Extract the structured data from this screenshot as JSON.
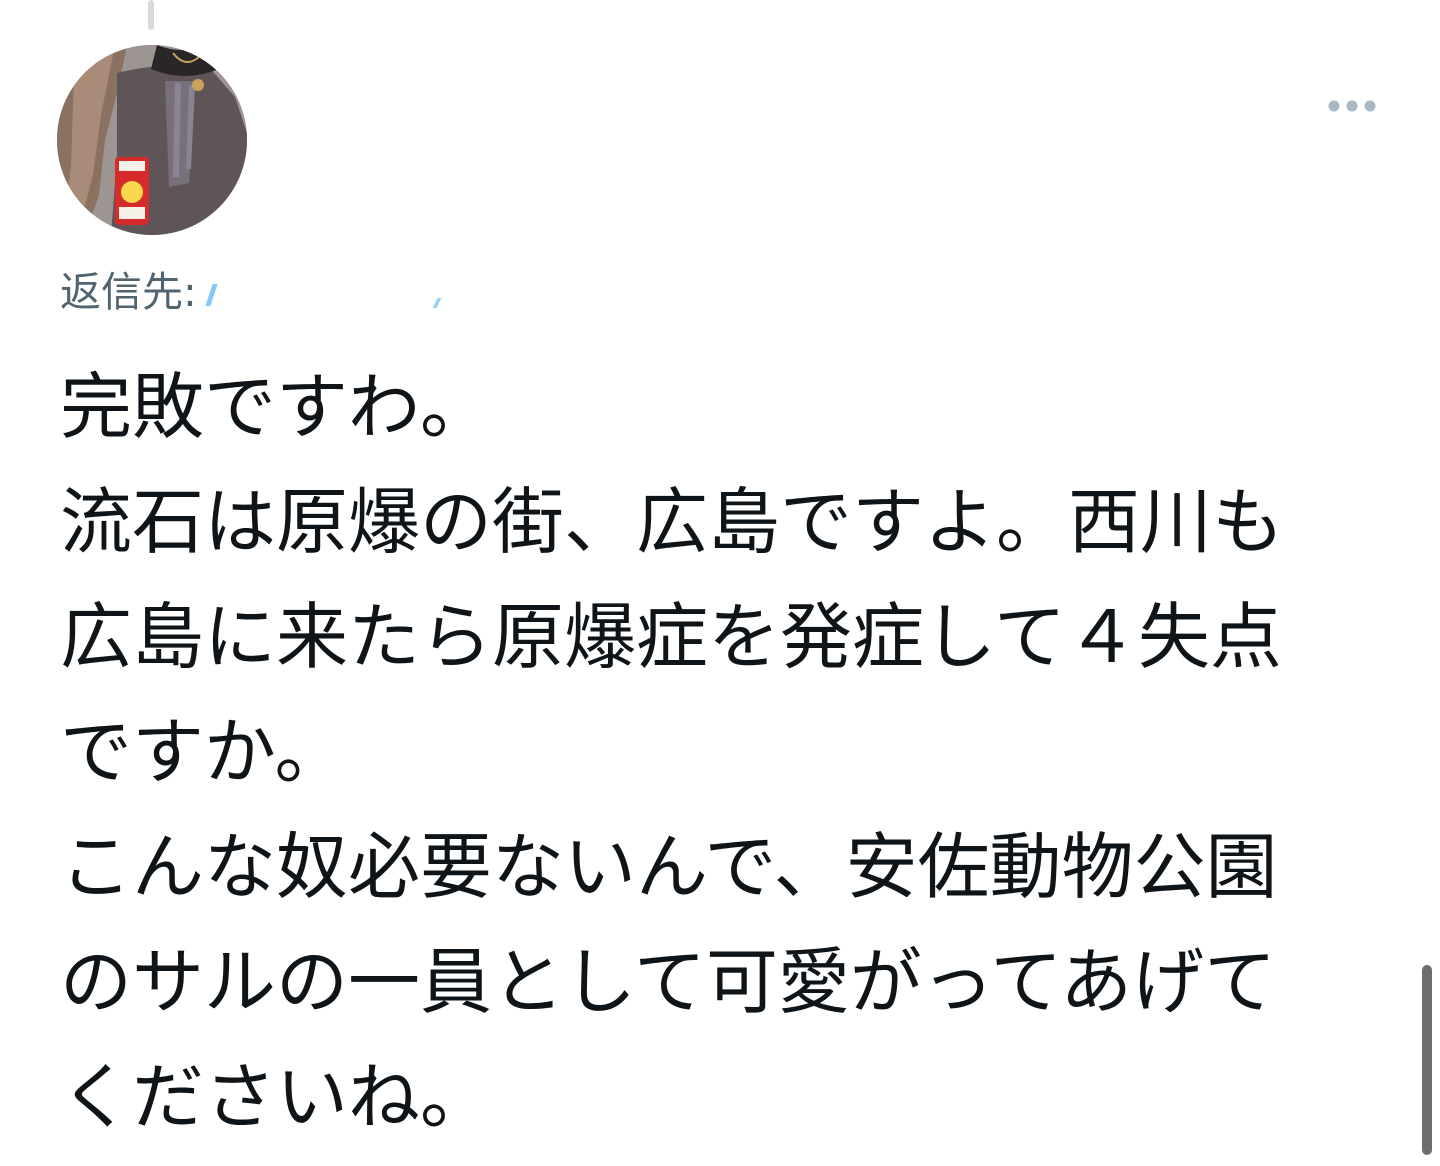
{
  "reply": {
    "prefix": "返信先:",
    "handle": ""
  },
  "tweet": {
    "lines": [
      "完敗ですわ。",
      "流石は原爆の街、広島ですよ。西川も",
      "広島に来たら原爆症を発症して４失点",
      "ですか。",
      "こんな奴必要ないんで、安佐動物公園",
      "のサルの一員として可愛がってあげて",
      "くださいね。"
    ]
  },
  "icons": {
    "more": "more-horizontal-icon"
  },
  "colors": {
    "text": "#0f1419",
    "muted": "#536471",
    "accent": "#1d9bf0",
    "background": "#ffffff"
  }
}
